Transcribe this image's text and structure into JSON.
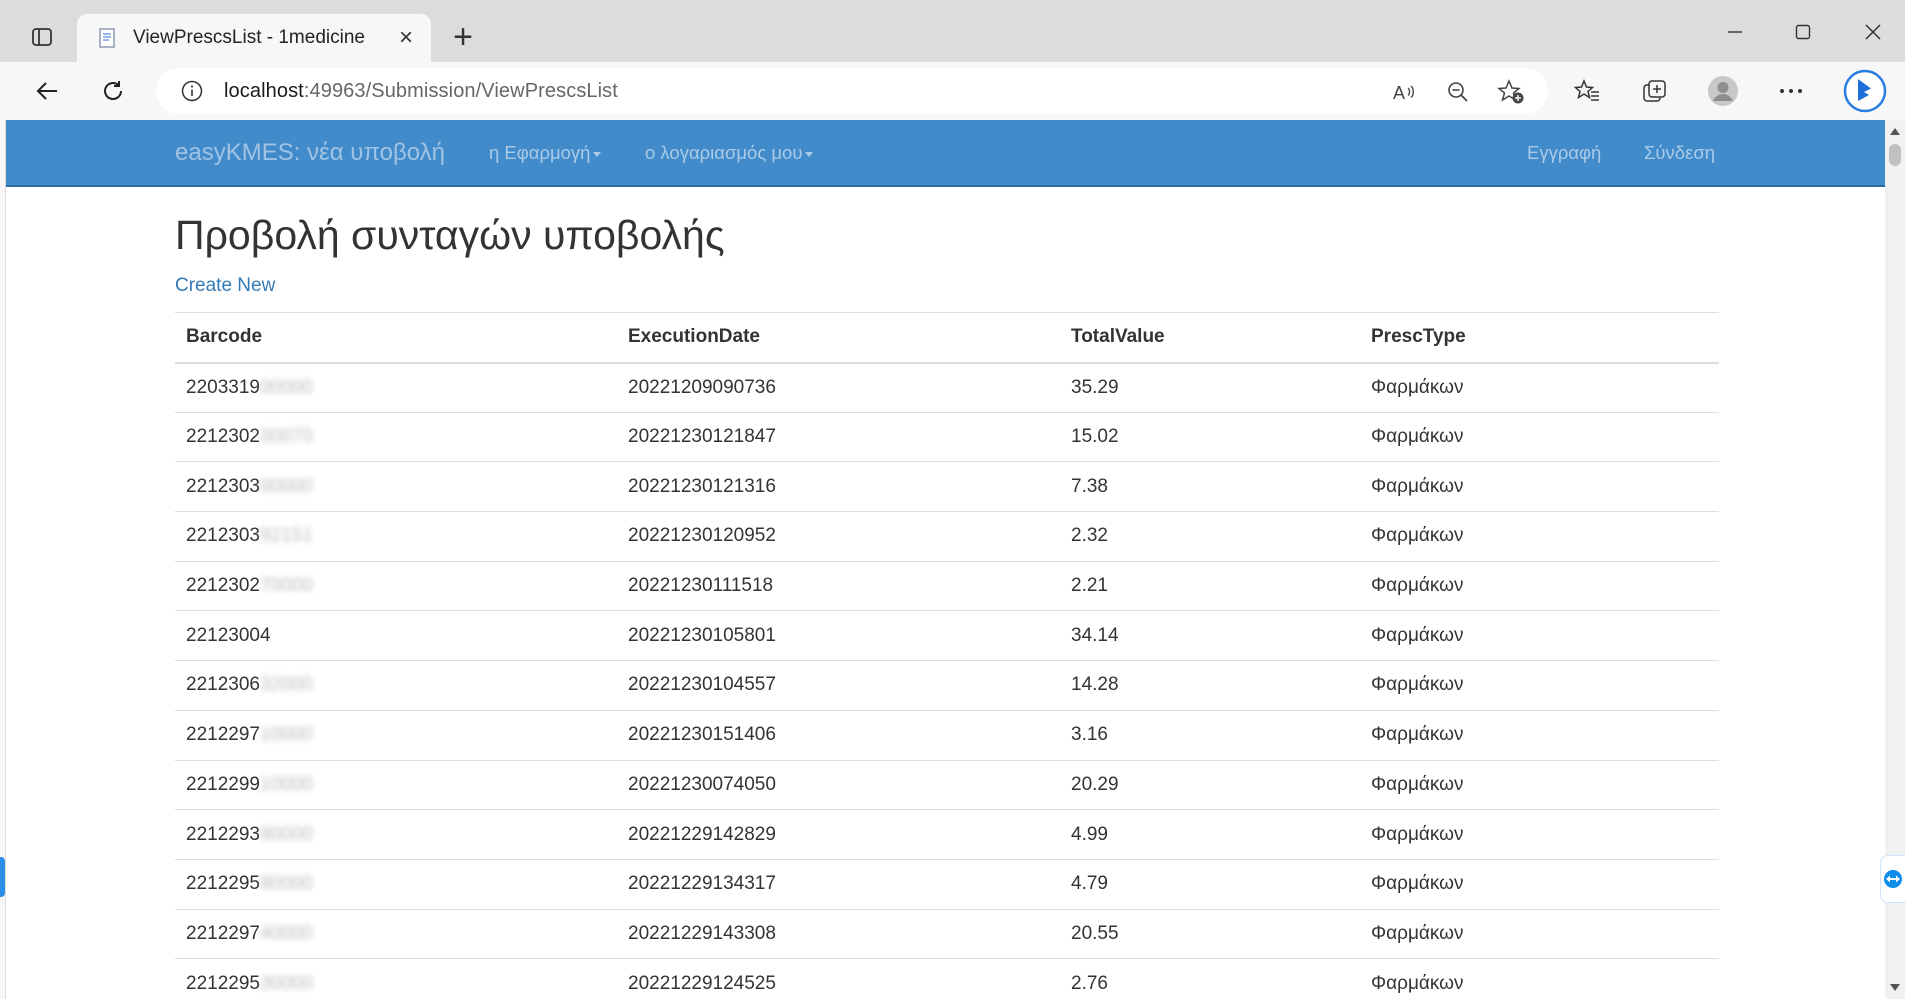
{
  "browser": {
    "tab_title": "ViewPrescsList - 1medicine",
    "tab_close": "×",
    "new_tab": "+",
    "url_host": "localhost",
    "url_rest": ":49963/Submission/ViewPrescsList",
    "icons": [
      "tab-actions-icon",
      "page-favicon",
      "back-icon",
      "refresh-icon",
      "info-icon",
      "read-aloud-icon",
      "zoom-out-icon",
      "add-favorite-icon",
      "favorites-icon",
      "collections-icon",
      "profile-icon",
      "more-icon",
      "bing-copilot-icon",
      "minimize-icon",
      "maximize-icon",
      "close-window-icon"
    ]
  },
  "navbar": {
    "brand": "easyKMES: νέα υποβολή",
    "app_menu": "η Εφαρμογή",
    "account_menu": "ο λογαριασμός μου",
    "register": "Εγγραφή",
    "login": "Σύνδεση"
  },
  "page": {
    "title": "Προβολή συνταγών υποβολής",
    "create_new": "Create New"
  },
  "table": {
    "headers": [
      "Barcode",
      "ExecutionDate",
      "TotalValue",
      "PrescType"
    ],
    "rows": [
      {
        "barcode": "2203319",
        "barcode_hidden": "00000",
        "date": "20221209090736",
        "value": "35.29",
        "type": "Φαρμάκων"
      },
      {
        "barcode": "2212302",
        "barcode_hidden": "00070",
        "date": "20221230121847",
        "value": "15.02",
        "type": "Φαρμάκων"
      },
      {
        "barcode": "2212303",
        "barcode_hidden": "00000",
        "date": "20221230121316",
        "value": "7.38",
        "type": "Φαρμάκων"
      },
      {
        "barcode": "2212303",
        "barcode_hidden": "92151",
        "date": "20221230120952",
        "value": "2.32",
        "type": "Φαρμάκων"
      },
      {
        "barcode": "2212302",
        "barcode_hidden": "70000",
        "date": "20221230111518",
        "value": "2.21",
        "type": "Φαρμάκων"
      },
      {
        "barcode": "22123004",
        "barcode_hidden": "",
        "date": "20221230105801",
        "value": "34.14",
        "type": "Φαρμάκων"
      },
      {
        "barcode": "2212306",
        "barcode_hidden": "32000",
        "date": "20221230104557",
        "value": "14.28",
        "type": "Φαρμάκων"
      },
      {
        "barcode": "2212297",
        "barcode_hidden": "10000",
        "date": "20221230151406",
        "value": "3.16",
        "type": "Φαρμάκων"
      },
      {
        "barcode": "2212299",
        "barcode_hidden": "10000",
        "date": "20221230074050",
        "value": "20.29",
        "type": "Φαρμάκων"
      },
      {
        "barcode": "2212293",
        "barcode_hidden": "90000",
        "date": "20221229142829",
        "value": "4.99",
        "type": "Φαρμάκων"
      },
      {
        "barcode": "2212295",
        "barcode_hidden": "80000",
        "date": "20221229134317",
        "value": "4.79",
        "type": "Φαρμάκων"
      },
      {
        "barcode": "2212297",
        "barcode_hidden": "40000",
        "date": "20221229143308",
        "value": "20.55",
        "type": "Φαρμάκων"
      },
      {
        "barcode": "2212295",
        "barcode_hidden": "30000",
        "date": "20221229124525",
        "value": "2.76",
        "type": "Φαρμάκων"
      }
    ]
  },
  "colors": {
    "navbar": "#428bca",
    "link": "#337ab7"
  }
}
